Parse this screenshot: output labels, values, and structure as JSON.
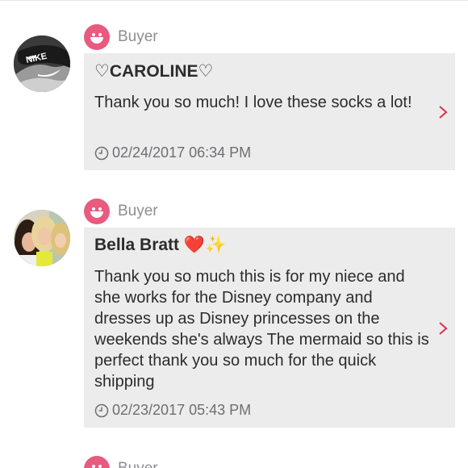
{
  "reviews": [
    {
      "role": "Buyer",
      "name": "♡CAROLINE♡",
      "message": "Thank you so much! I love these socks a lot!",
      "timestamp": "02/24/2017 06:34 PM",
      "avatar_icon": "nike-shoes-photo"
    },
    {
      "role": "Buyer",
      "name": "Bella Bratt",
      "name_emoji": "❤️✨",
      "message": "Thank you so much this is for my niece and she works for the Disney company and dresses up as Disney princesses on the weekends she's always The mermaid so this is perfect thank you so much for the quick shipping",
      "timestamp": "02/23/2017 05:43 PM",
      "avatar_icon": "group-selfie-photo"
    },
    {
      "role": "Buyer"
    }
  ],
  "colors": {
    "accent_pink": "#e85a7e",
    "bubble_bg": "#ececec",
    "chevron_red": "#e0304a",
    "muted_text": "#8e8e93"
  },
  "icons": {
    "buyer_badge": "smiley-face-icon",
    "timestamp": "clock-icon",
    "detail": "chevron-right-icon"
  }
}
